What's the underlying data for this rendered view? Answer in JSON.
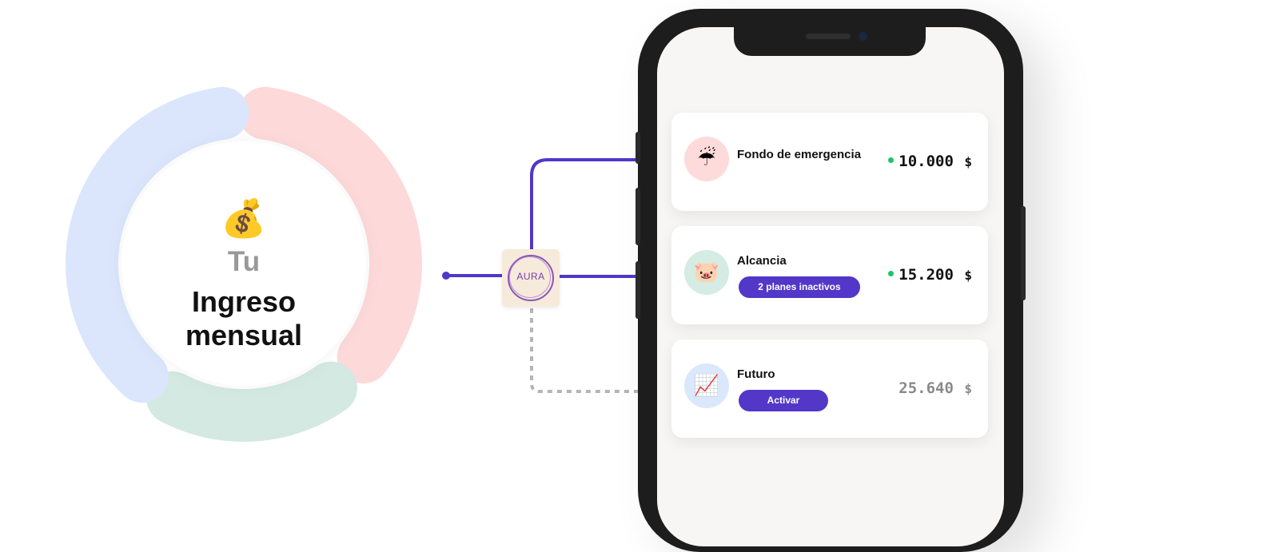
{
  "colors": {
    "brand_purple": "#5237c9",
    "connector_inactive": "#b5b5b5",
    "donut_blue": "#dbe6fc",
    "donut_red": "#fdd9d9",
    "donut_green": "#d3e9e1",
    "active_dot": "#1cc46b"
  },
  "income": {
    "icon": "money-bag-icon",
    "emoji": "💰",
    "title_small": "Tu",
    "title_large": "Ingreso mensual"
  },
  "router": {
    "logo_text": "AURA",
    "logo": "aura-logo"
  },
  "accounts": [
    {
      "title": "Fondo de emergencia",
      "icon": "umbrella-icon",
      "emoji": "☔",
      "icon_bg": "#fddbdb",
      "amount": "10.000",
      "currency": "$",
      "status": "active"
    },
    {
      "title": "Alcancia",
      "icon": "pig-icon",
      "emoji": "🐷",
      "icon_bg": "#d4ece3",
      "badge": "2 planes inactivos",
      "amount": "15.200",
      "currency": "$",
      "status": "active"
    },
    {
      "title": "Futuro",
      "icon": "chart-increasing-icon",
      "emoji": "📈",
      "icon_bg": "#dbe8fb",
      "button": "Activar",
      "amount": "25.640",
      "currency": "$",
      "status": "inactive"
    }
  ]
}
